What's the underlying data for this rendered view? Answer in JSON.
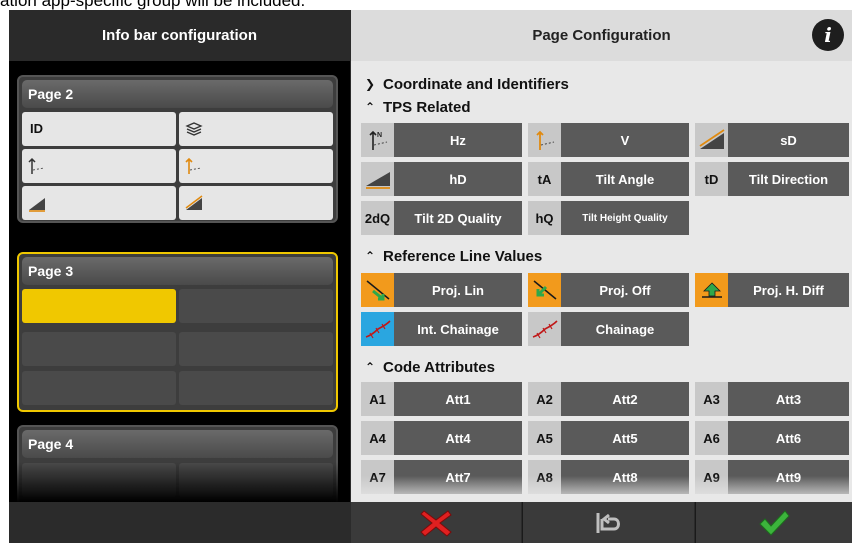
{
  "overflow_text": "ation app-specific group will be included.",
  "left_panel": {
    "title": "Info bar configuration",
    "pages": [
      {
        "label": "Page 2",
        "cells": [
          {
            "label": "ID",
            "icon": ""
          },
          {
            "label": "",
            "icon": "layers-icon"
          },
          {
            "label": "",
            "icon": "hz-angle-icon"
          },
          {
            "label": "",
            "icon": "v-angle-icon"
          },
          {
            "label": "",
            "icon": "hd-slope-icon"
          },
          {
            "label": "",
            "icon": "sd-slope-icon"
          }
        ]
      },
      {
        "label": "Page 3"
      },
      {
        "label": "Page 4"
      }
    ]
  },
  "right_panel": {
    "title": "Page Configuration",
    "info_icon": "i",
    "sections": {
      "coordinate": "Coordinate and Identifiers",
      "tps": "TPS Related",
      "reference": "Reference Line Values",
      "code": "Code Attributes"
    },
    "tps_fields": [
      {
        "prefix": "",
        "label": "Hz",
        "icon": "hz-icon"
      },
      {
        "prefix": "",
        "label": "V",
        "icon": "v-icon"
      },
      {
        "prefix": "",
        "label": "sD",
        "icon": "sd-icon"
      },
      {
        "prefix": "",
        "label": "hD",
        "icon": "hd-icon"
      },
      {
        "prefix": "tA",
        "label": "Tilt Angle"
      },
      {
        "prefix": "tD",
        "label": "Tilt Direction"
      },
      {
        "prefix": "2dQ",
        "label": "Tilt 2D Quality"
      },
      {
        "prefix": "hQ",
        "label": "Tilt Height Quality"
      }
    ],
    "reference_fields": [
      {
        "label": "Proj. Lin",
        "icon": "proj-lin-icon"
      },
      {
        "label": "Proj. Off",
        "icon": "proj-off-icon"
      },
      {
        "label": "Proj. H. Diff",
        "icon": "proj-hdiff-icon"
      },
      {
        "label": "Int. Chainage",
        "icon": "int-chainage-icon"
      },
      {
        "label": "Chainage",
        "icon": "chainage-icon"
      }
    ],
    "code_fields": [
      {
        "prefix": "A1",
        "label": "Att1"
      },
      {
        "prefix": "A2",
        "label": "Att2"
      },
      {
        "prefix": "A3",
        "label": "Att3"
      },
      {
        "prefix": "A4",
        "label": "Att4"
      },
      {
        "prefix": "A5",
        "label": "Att5"
      },
      {
        "prefix": "A6",
        "label": "Att6"
      },
      {
        "prefix": "A7",
        "label": "Att7"
      },
      {
        "prefix": "A8",
        "label": "Att8"
      },
      {
        "prefix": "A9",
        "label": "Att9"
      }
    ]
  },
  "bottom_bar": {
    "cancel_icon": "red-x-icon",
    "undo_icon": "undo-icon",
    "confirm_icon": "green-check-icon"
  },
  "colors": {
    "accent_yellow": "#f0c800",
    "orange": "#f29a1c",
    "blue": "#2aa6e0",
    "cancel_red": "#e02020",
    "confirm_green": "#3cb43c"
  }
}
